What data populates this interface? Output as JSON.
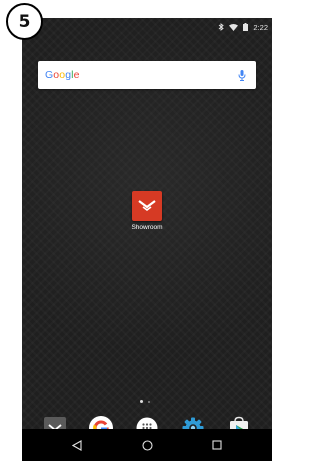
{
  "step": {
    "number": "5"
  },
  "status_bar": {
    "time": "2:22",
    "icons": [
      "bluetooth-icon",
      "wifi-icon",
      "battery-icon"
    ]
  },
  "search": {
    "logo_text": "Google",
    "mic_icon": "mic-icon"
  },
  "home_app": {
    "label": "Showroom",
    "icon": "vizio-chevron-icon",
    "color": "#d63a24"
  },
  "page_indicator": {
    "pages": 2,
    "current": 1
  },
  "dock": {
    "items": [
      {
        "name": "Vizio",
        "icon": "vizio-chevron-icon"
      },
      {
        "name": "Google",
        "icon": "google-g-icon"
      },
      {
        "name": "All apps",
        "icon": "app-drawer-icon"
      },
      {
        "name": "Settings",
        "icon": "settings-gear-icon"
      },
      {
        "name": "Play Store",
        "icon": "play-store-icon"
      }
    ]
  },
  "nav_bar": {
    "buttons": [
      "back-icon",
      "home-icon",
      "recents-icon"
    ]
  },
  "colors": {
    "wallpaper": "#1f1f1f",
    "accent_red": "#d63a24",
    "nav": "#000000"
  }
}
